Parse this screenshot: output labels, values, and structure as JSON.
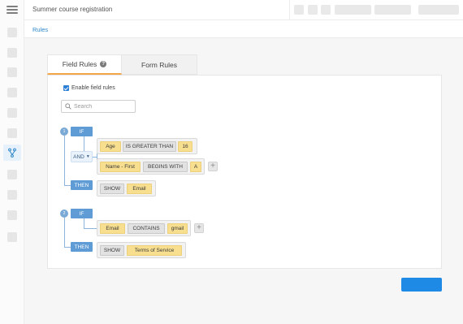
{
  "header": {
    "title": "Summer course registration"
  },
  "breadcrumb": "Rules",
  "tabs": [
    {
      "label": "Field Rules",
      "active": true,
      "icon": "help-icon"
    },
    {
      "label": "Form Rules",
      "active": false
    }
  ],
  "enable": {
    "label": "Enable field rules",
    "checked": true
  },
  "search": {
    "placeholder": "Search",
    "value": ""
  },
  "rules": [
    {
      "number": "1",
      "if_label": "IF",
      "conditions": [
        {
          "field": "Age",
          "operator": "IS GREATER THAN",
          "value": "16"
        },
        {
          "field": "Name - First",
          "operator": "BEGINS WITH",
          "value": "A"
        }
      ],
      "join_label": "AND",
      "then_label": "THEN",
      "action": {
        "verb": "SHOW",
        "target": "Email"
      }
    },
    {
      "number": "2",
      "if_label": "IF",
      "conditions": [
        {
          "field": "Email",
          "operator": "CONTAINS",
          "value": "gmail"
        }
      ],
      "then_label": "THEN",
      "action": {
        "verb": "SHOW",
        "target": "Terms of Service"
      }
    }
  ],
  "add_icon": "plus-icon",
  "colors": {
    "accent": "#1e8ae6",
    "tab_underline": "#f3a64a",
    "chip_value": "#f8df8f",
    "label_blue": "#5f9cd6"
  }
}
